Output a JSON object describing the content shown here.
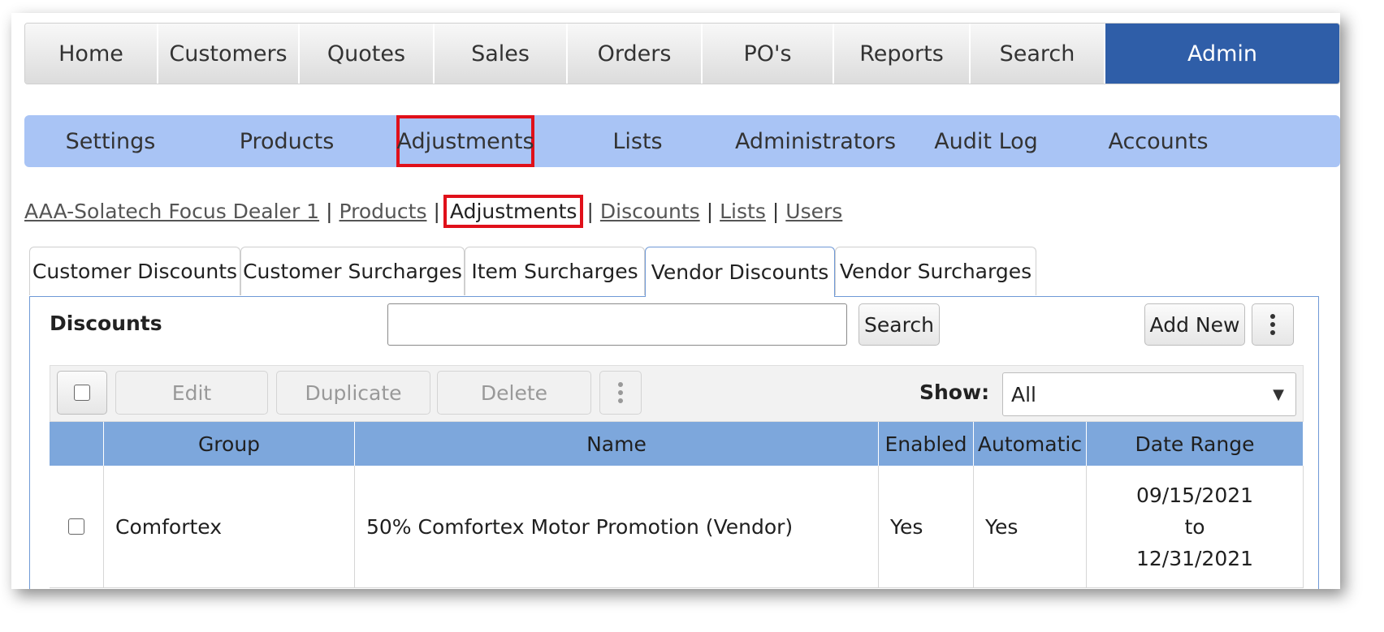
{
  "top_nav": {
    "items": [
      "Home",
      "Customers",
      "Quotes",
      "Sales",
      "Orders",
      "PO's",
      "Reports",
      "Search",
      "Admin"
    ],
    "active": "Admin"
  },
  "sub_nav": {
    "items": [
      "Settings",
      "Products",
      "Adjustments",
      "Lists",
      "Administrators",
      "Audit Log",
      "Accounts"
    ],
    "highlighted": "Adjustments"
  },
  "breadcrumb": {
    "dealer": "AAA-Solatech Focus Dealer 1",
    "products": "Products",
    "adjustments": "Adjustments",
    "discounts": "Discounts",
    "lists": "Lists",
    "users": "Users",
    "separator": "|"
  },
  "tabs": [
    "Customer Discounts",
    "Customer Surcharges",
    "Item Surcharges",
    "Vendor Discounts",
    "Vendor Surcharges"
  ],
  "active_tab": "Vendor Discounts",
  "panel": {
    "title": "Discounts",
    "search_value": "",
    "search_button": "Search",
    "add_new_button": "Add New"
  },
  "toolbar": {
    "edit": "Edit",
    "duplicate": "Duplicate",
    "delete": "Delete",
    "show_label": "Show:",
    "show_value": "All"
  },
  "table": {
    "columns": [
      "Group",
      "Name",
      "Enabled",
      "Automatic",
      "Date Range"
    ],
    "rows": [
      {
        "group": "Comfortex",
        "name": "50% Comfortex Motor Promotion (Vendor)",
        "enabled": "Yes",
        "automatic": "Yes",
        "date_from": "09/15/2021",
        "date_to_word": "to",
        "date_to": "12/31/2021"
      }
    ]
  },
  "colors": {
    "admin_active": "#2f5ea8",
    "subnav_bg": "#a9c4f5",
    "highlight_box": "#e0101a",
    "table_header": "#7da7dc"
  }
}
